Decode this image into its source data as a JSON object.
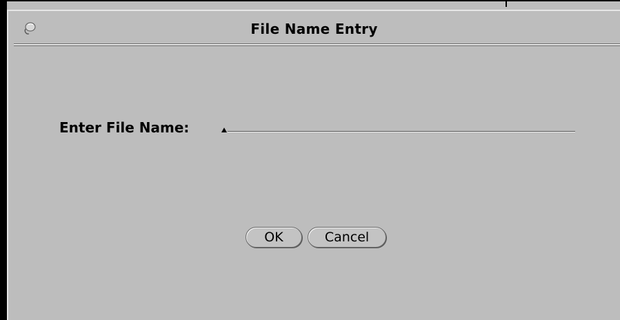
{
  "window": {
    "title": "File Name Entry"
  },
  "form": {
    "label": "Enter File Name:",
    "value": ""
  },
  "buttons": {
    "ok_label": "OK",
    "cancel_label": "Cancel"
  },
  "icons": {
    "window_menu": "window-menu-icon",
    "caret": "text-caret-icon"
  }
}
